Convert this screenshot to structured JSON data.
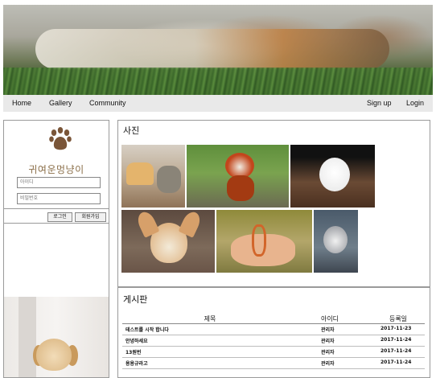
{
  "nav": {
    "left": [
      "Home",
      "Gallery",
      "Community"
    ],
    "right": [
      "Sign up",
      "Login"
    ]
  },
  "sidebar": {
    "site_title": "귀여운멍냥이",
    "id_placeholder": "아이디",
    "pw_placeholder": "비밀번호",
    "login_button": "로그인",
    "signup_button": "회원가입"
  },
  "photos": {
    "title": "사진"
  },
  "board": {
    "title": "게시판",
    "columns": [
      "제목",
      "아이디",
      "등록일"
    ],
    "rows": [
      {
        "title": "테스트를 시작 합니다",
        "author": "관리자",
        "date": "2017-11-23"
      },
      {
        "title": "안녕하세요",
        "author": "관리자",
        "date": "2017-11-24"
      },
      {
        "title": "13원번",
        "author": "관리자",
        "date": "2017-11-24"
      },
      {
        "title": "용용규라고",
        "author": "관리자",
        "date": "2017-11-24"
      }
    ]
  },
  "colors": {
    "nav_bg": "#e9e9e9",
    "title_brown": "#8a6e48",
    "paw_brown": "#7a5538",
    "border": "#9a9a9a"
  }
}
